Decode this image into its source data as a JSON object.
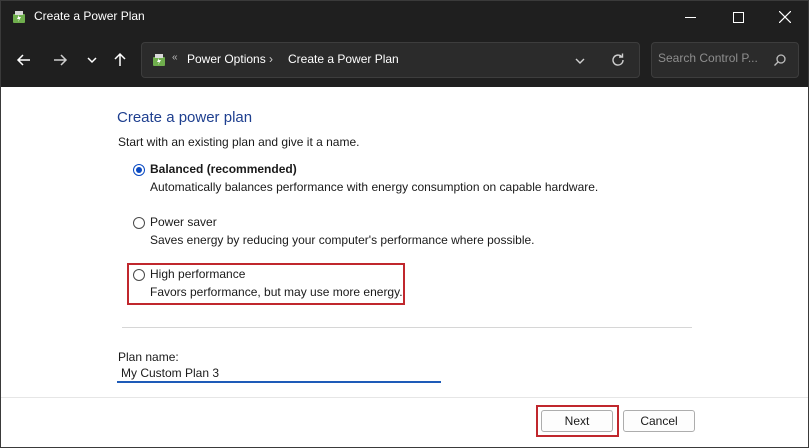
{
  "window": {
    "title": "Create a Power Plan",
    "icon": "power-options-icon",
    "controls": [
      "minimize-icon",
      "maximize-icon",
      "close-icon"
    ]
  },
  "navbar": {
    "back_icon": "arrow-left-icon",
    "forward_icon": "arrow-right-icon",
    "recent_icon": "chevron-down-icon",
    "up_icon": "arrow-up-icon",
    "breadcrumb_prefix": "«",
    "breadcrumbs": [
      "Power Options",
      "Create a Power Plan"
    ],
    "breadcrumb_separator": "›",
    "search_placeholder": "Search Control P..."
  },
  "main": {
    "heading": "Create a power plan",
    "intro": "Start with an existing plan and give it a name.",
    "options": [
      {
        "label": "Balanced (recommended)",
        "description": "Automatically balances performance with energy consumption on capable hardware.",
        "checked": true
      },
      {
        "label": "Power saver",
        "description": "Saves energy by reducing your computer's performance where possible.",
        "checked": false
      },
      {
        "label": "High performance",
        "description": "Favors performance, but may use more energy.",
        "checked": false
      }
    ],
    "plan_name_label": "Plan name:",
    "plan_name_value": "My Custom Plan 3"
  },
  "footer": {
    "next_label": "Next",
    "cancel_label": "Cancel"
  },
  "colors": {
    "titlebar_bg": "#1f1f1f",
    "heading": "#1e3f8f",
    "highlight_border": "#c0272d",
    "radio_checked": "#0a4ac2"
  }
}
